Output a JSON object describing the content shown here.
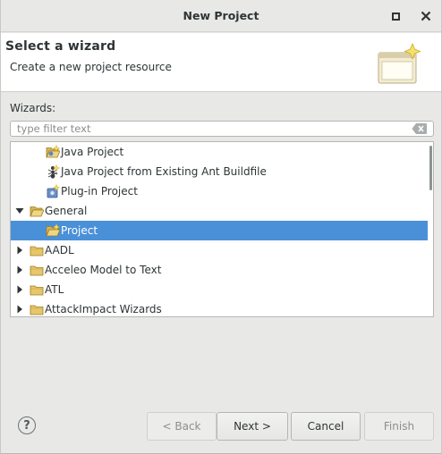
{
  "window": {
    "title": "New Project"
  },
  "header": {
    "title": "Select a wizard",
    "description": "Create a new project resource"
  },
  "wizards_label": "Wizards:",
  "filter": {
    "placeholder": "type filter text",
    "value": ""
  },
  "tree": {
    "items": [
      {
        "label": "Java Project",
        "icon": "java-project-icon",
        "depth": 1,
        "expander": "none",
        "selected": false
      },
      {
        "label": "Java Project from Existing Ant Buildfile",
        "icon": "ant-icon",
        "depth": 1,
        "expander": "none",
        "selected": false
      },
      {
        "label": "Plug-in Project",
        "icon": "plugin-icon",
        "depth": 1,
        "expander": "none",
        "selected": false
      },
      {
        "label": "General",
        "icon": "folder-open-icon",
        "depth": 0,
        "expander": "expanded",
        "selected": false
      },
      {
        "label": "Project",
        "icon": "project-icon",
        "depth": 1,
        "expander": "none",
        "selected": true
      },
      {
        "label": "AADL",
        "icon": "folder-icon",
        "depth": 0,
        "expander": "collapsed",
        "selected": false
      },
      {
        "label": "Acceleo Model to Text",
        "icon": "folder-icon",
        "depth": 0,
        "expander": "collapsed",
        "selected": false
      },
      {
        "label": "ATL",
        "icon": "folder-icon",
        "depth": 0,
        "expander": "collapsed",
        "selected": false
      },
      {
        "label": "AttackImpact Wizards",
        "icon": "folder-icon",
        "depth": 0,
        "expander": "collapsed",
        "selected": false
      }
    ]
  },
  "buttons": {
    "help": "?",
    "back": "< Back",
    "next": "Next >",
    "cancel": "Cancel",
    "finish": "Finish"
  },
  "colors": {
    "selection": "#4a90d9",
    "background": "#e8e8e7",
    "header_background": "#ffffff"
  }
}
